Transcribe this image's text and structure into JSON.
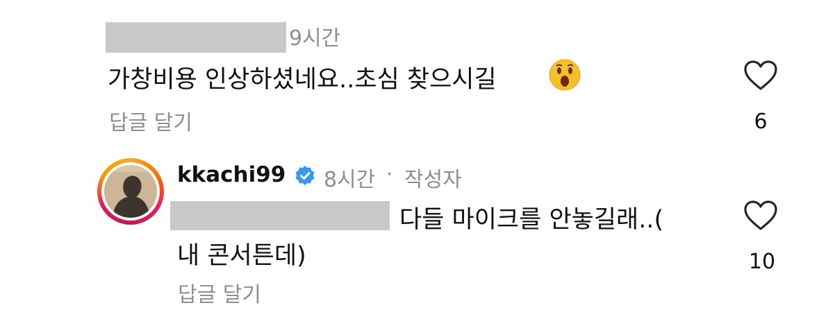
{
  "comment1": {
    "time": "9시간",
    "text": "가창비용 인상하셨네요..초심 찾으시길",
    "emoji": "face-with-open-mouth-emoji",
    "reply_label": "답글 달기",
    "like_count": "6"
  },
  "comment2": {
    "username": "kkachi99",
    "verified_icon": "verified-badge-icon",
    "time": "8시간",
    "separator": "·",
    "author_tag": "작성자",
    "text_line1": "다들 마이크를 안놓길래..(",
    "text_line2": "내 콘서튼데)",
    "reply_label": "답글 달기",
    "like_count": "10"
  },
  "colors": {
    "muted": "#8e8e8e",
    "redaction": "#c8c8c8",
    "verified": "#3897f0",
    "story_ring": [
      "#f9a825",
      "#e91e63"
    ]
  }
}
